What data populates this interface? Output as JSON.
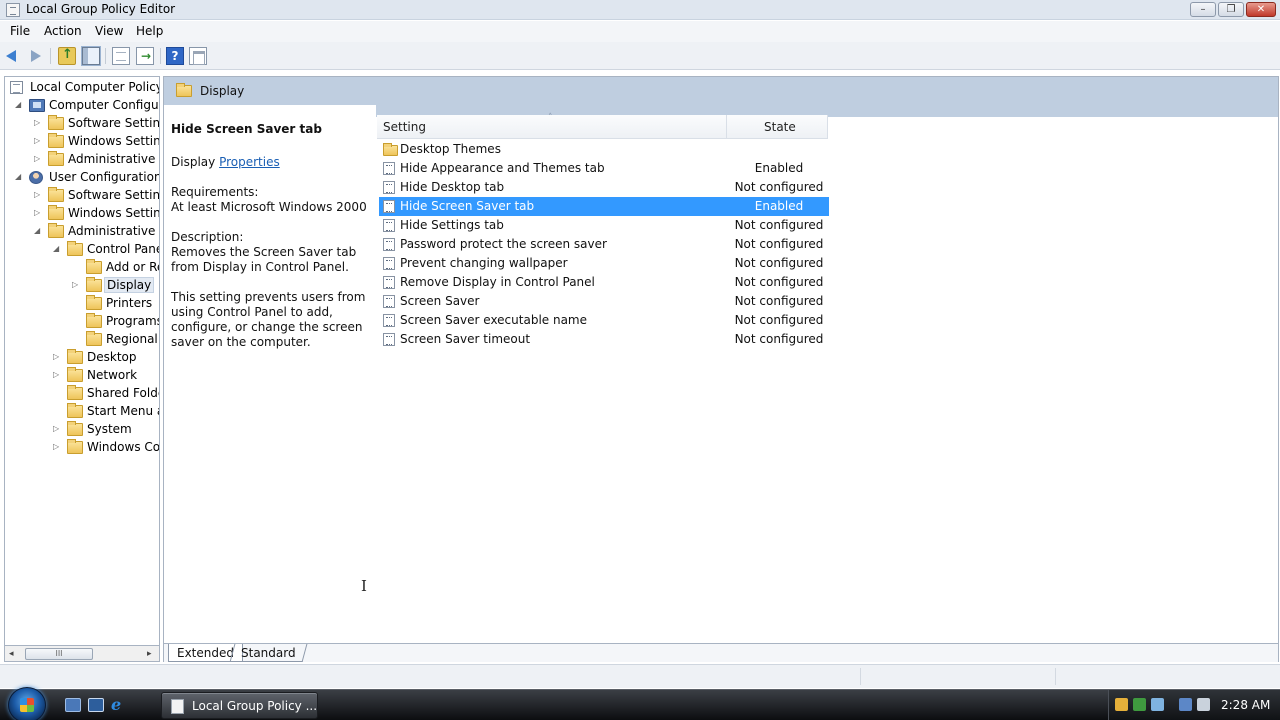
{
  "window": {
    "title": "Local Group Policy Editor",
    "minimize": "–",
    "maximize": "❐",
    "close": "✕"
  },
  "menu": [
    "File",
    "Action",
    "View",
    "Help"
  ],
  "toolbar": {
    "icons": [
      "back-icon",
      "forward-icon",
      "up-folder-icon",
      "show-hide-tree-icon",
      "properties-icon",
      "export-list-icon",
      "help-icon",
      "extended-view-icon"
    ],
    "help_glyph": "?"
  },
  "tree": {
    "items": [
      {
        "label": "Local Computer Policy",
        "icon": "policy-icon",
        "expander": ""
      },
      {
        "label": "Computer Configura",
        "icon": "computer-icon",
        "expander": "◢"
      },
      {
        "label": "Software Settings",
        "icon": "folder-icon",
        "expander": "▷"
      },
      {
        "label": "Windows Setting",
        "icon": "folder-icon",
        "expander": "▷"
      },
      {
        "label": "Administrative Te",
        "icon": "folder-icon",
        "expander": "▷"
      },
      {
        "label": "User Configuration",
        "icon": "user-icon",
        "expander": "◢"
      },
      {
        "label": "Software Settings",
        "icon": "folder-icon",
        "expander": "▷"
      },
      {
        "label": "Windows Setting",
        "icon": "folder-icon",
        "expander": "▷"
      },
      {
        "label": "Administrative Te",
        "icon": "folder-icon",
        "expander": "◢"
      },
      {
        "label": "Control Panel",
        "icon": "folder-icon",
        "expander": "◢"
      },
      {
        "label": "Add or Re",
        "icon": "folder-icon",
        "expander": ""
      },
      {
        "label": "Display",
        "icon": "folder-icon",
        "expander": "▷",
        "selected": true
      },
      {
        "label": "Printers",
        "icon": "folder-icon",
        "expander": ""
      },
      {
        "label": "Programs",
        "icon": "folder-icon",
        "expander": ""
      },
      {
        "label": "Regional a",
        "icon": "folder-icon",
        "expander": ""
      },
      {
        "label": "Desktop",
        "icon": "folder-icon",
        "expander": "▷"
      },
      {
        "label": "Network",
        "icon": "folder-icon",
        "expander": "▷"
      },
      {
        "label": "Shared Folder",
        "icon": "folder-icon",
        "expander": ""
      },
      {
        "label": "Start Menu ar",
        "icon": "folder-icon",
        "expander": ""
      },
      {
        "label": "System",
        "icon": "folder-icon",
        "expander": "▷"
      },
      {
        "label": "Windows Cor",
        "icon": "folder-icon",
        "expander": "▷"
      }
    ],
    "scroll": {
      "left": "◂",
      "right": "▸",
      "thumb": "III"
    }
  },
  "panel": {
    "title": "Display"
  },
  "description": {
    "heading": "Hide Screen Saver tab",
    "display_prefix": "Display",
    "properties_link": "Properties",
    "requirements_label": "Requirements:",
    "requirements_value": "At least Microsoft Windows 2000",
    "description_label": "Description:",
    "description_text": "Removes the Screen Saver tab from Display in Control Panel.",
    "detail_text": "This setting prevents users from using Control Panel to add, configure, or change the screen saver on the computer."
  },
  "columns": {
    "setting": "Setting",
    "state": "State",
    "sort_glyph": "˄"
  },
  "rows": [
    {
      "name": "Desktop Themes",
      "state": "",
      "icon": "folder-icon"
    },
    {
      "name": "Hide Appearance and Themes tab",
      "state": "Enabled",
      "icon": "setting-icon"
    },
    {
      "name": "Hide Desktop tab",
      "state": "Not configured",
      "icon": "setting-icon"
    },
    {
      "name": "Hide Screen Saver tab",
      "state": "Enabled",
      "icon": "setting-icon",
      "selected": true
    },
    {
      "name": "Hide Settings tab",
      "state": "Not configured",
      "icon": "setting-icon"
    },
    {
      "name": "Password protect the screen saver",
      "state": "Not configured",
      "icon": "setting-icon"
    },
    {
      "name": "Prevent changing wallpaper",
      "state": "Not configured",
      "icon": "setting-icon"
    },
    {
      "name": "Remove Display in Control Panel",
      "state": "Not configured",
      "icon": "setting-icon"
    },
    {
      "name": "Screen Saver",
      "state": "Not configured",
      "icon": "setting-icon"
    },
    {
      "name": "Screen Saver executable name",
      "state": "Not configured",
      "icon": "setting-icon"
    },
    {
      "name": "Screen Saver timeout",
      "state": "Not configured",
      "icon": "setting-icon"
    }
  ],
  "tabs": {
    "extended": "Extended",
    "standard": "Standard"
  },
  "cursor_glyph": "I",
  "taskbar": {
    "task_label": "Local Group Policy ...",
    "clock": "2:28 AM",
    "ie_glyph": "e"
  },
  "colors": {
    "selection": "#3399ff",
    "header_band": "#bfcee0",
    "link": "#1a5fb4"
  }
}
